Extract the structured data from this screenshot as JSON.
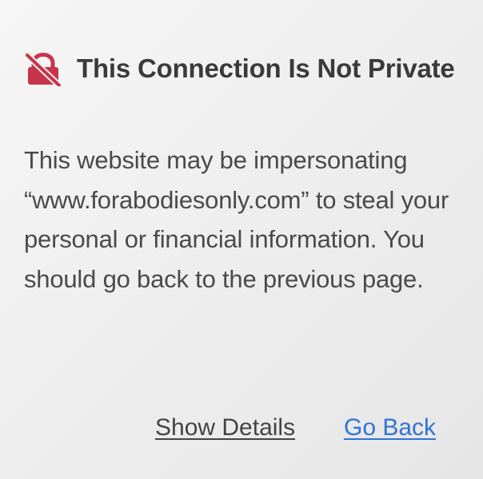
{
  "warning": {
    "icon": "lock-slash-icon",
    "title": "This Connection Is Not Private",
    "message": "This website may be impersonating “www.forabodiesonly.com” to steal your personal or financial information. You should go back to the previous page.",
    "colors": {
      "icon": "#c8344a",
      "text": "#4a4a4a",
      "link": "#2f73d6"
    }
  },
  "actions": {
    "show_details_label": "Show Details",
    "go_back_label": "Go Back"
  }
}
